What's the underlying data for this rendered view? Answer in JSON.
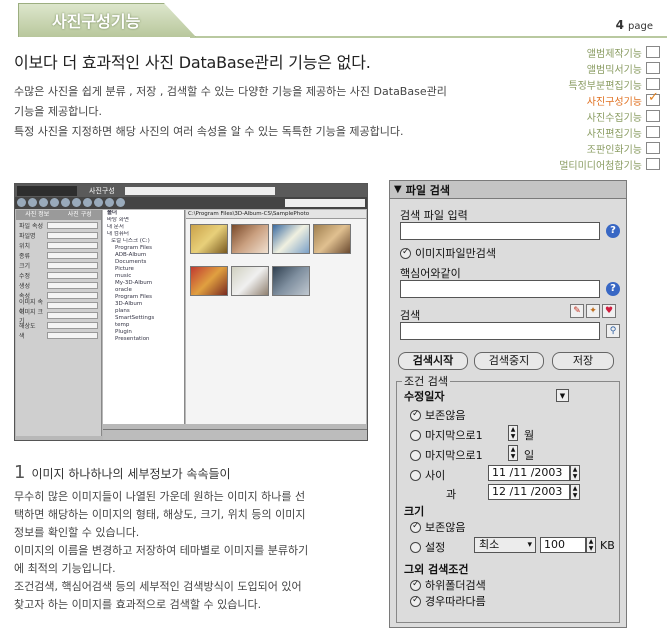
{
  "header": {
    "title": "사진구성기능",
    "page_number": "4",
    "page_word": "page"
  },
  "headline": "이보다 더 효과적인 사진 DataBase관리 기능은 없다.",
  "intro": {
    "line1": "수많은 사진을 쉽게 분류 , 저장 , 검색할 수 있는 다양한 기능을 제공하는 사진 DataBase관리",
    "line2": "기능을 제공합니다.",
    "line3": "특정 사진을 지정하면 해당 사진의 여러 속성을 알 수 있는 독특한 기능을 제공합니다."
  },
  "features": [
    {
      "label": "앨범제작기능",
      "checked": false
    },
    {
      "label": "앨범믹서기능",
      "checked": false
    },
    {
      "label": "특정부분편집기능",
      "checked": false
    },
    {
      "label": "사진구성기능",
      "checked": true
    },
    {
      "label": "사진수집기능",
      "checked": false
    },
    {
      "label": "사진편집기능",
      "checked": false
    },
    {
      "label": "조판인화기능",
      "checked": false
    },
    {
      "label": "멀티미디어첨합기능",
      "checked": false
    }
  ],
  "screenshot": {
    "window_title": "사진구성",
    "left_tabs": [
      "사진 정보",
      "사진 구성"
    ],
    "left_rows": [
      "파일 속성",
      "파일명",
      "위치",
      "종류",
      "크기",
      "수정",
      "생성",
      "속성",
      "이미지 속성",
      "이미지 크기",
      "해상도",
      "색"
    ],
    "tree_header": "폴더",
    "tree_rows": [
      "바탕 화면",
      "내 문서",
      "내 컴퓨터",
      "로컬 디스크 (C:)",
      "Program Files",
      "ADB-Album",
      "Documents",
      "Picture",
      "music",
      "My-3D-Album",
      "oracle",
      "Program Files",
      "3D-Album",
      "plans",
      "SmartSettings",
      "temp",
      "Plugin",
      "Presentation"
    ],
    "path": "C:\\Program Files\\3D-Album-CS\\SamplePhoto"
  },
  "section1": {
    "number": "1",
    "title": "이미지 하나하나의 세부정보가 속속들이",
    "lines": [
      "무수히 많은 이미지들이 나열된 가운데 원하는 이미지 하나를 선",
      "택하면 해당하는 이미지의 형태, 해상도, 크기, 위치 등의 이미지",
      "정보를 확인할 수 있습니다.",
      "이미지의 이름을 변경하고 저장하여 테마별로 이미지를 분류하기",
      "에 최적의 기능입니다.",
      "조건검색, 핵심어검색 등의 세부적인 검색방식이 도입되어 있어",
      "찾고자 하는 이미지를 효과적으로 검색할 수 있습니다."
    ]
  },
  "search_panel": {
    "title": "파일 검색",
    "file_input_label": "검색 파일 입력",
    "image_only_label": "이미지파일만검색",
    "keyword_label": "핵심어와같이",
    "search_label": "검색",
    "buttons": {
      "start": "검색시작",
      "stop": "검색중지",
      "save": "저장"
    },
    "conditions_legend": "조건 검색",
    "date_heading": "수정일자",
    "date_opts": {
      "none": "보존않음",
      "last": "마지막으로1",
      "last_day": "마지막으로1",
      "between": "사이",
      "to": "과"
    },
    "units": {
      "month": "월",
      "day": "일",
      "kb": "KB"
    },
    "date_from": "11 /11 /2003",
    "date_to": "12 /11 /2003",
    "size_heading": "크기",
    "size_opts": {
      "none": "보존않음",
      "set": "설정"
    },
    "size_compare": "최소",
    "size_value": "100",
    "other_heading": "그외 검색조건",
    "other_opts": {
      "subfolder": "하위폴더검색",
      "case": "경우따라다름"
    },
    "help_symbol": "?"
  }
}
